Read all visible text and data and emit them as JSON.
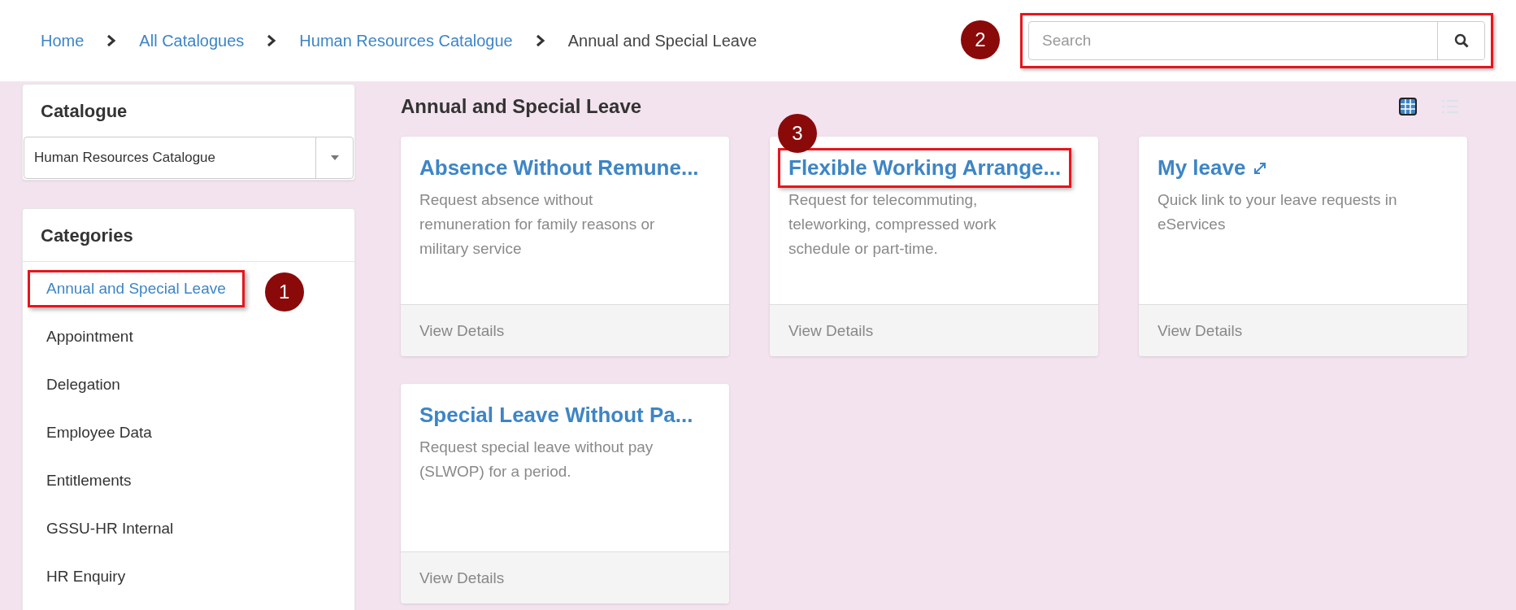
{
  "breadcrumb": [
    {
      "label": "Home",
      "link": true
    },
    {
      "label": "All Catalogues",
      "link": true
    },
    {
      "label": "Human Resources Catalogue",
      "link": true
    },
    {
      "label": "Annual and Special Leave",
      "link": false
    }
  ],
  "search": {
    "placeholder": "Search",
    "highlighted": true,
    "callout": "2"
  },
  "sidebar": {
    "catalogue": {
      "title": "Catalogue",
      "value": "Human Resources Catalogue"
    },
    "categories": {
      "title": "Categories",
      "items": [
        {
          "label": "Annual and Special Leave",
          "selected": true,
          "highlighted": true,
          "callout": "1"
        },
        {
          "label": "Appointment",
          "selected": false,
          "highlighted": false
        },
        {
          "label": "Delegation",
          "selected": false,
          "highlighted": false
        },
        {
          "label": "Employee Data",
          "selected": false,
          "highlighted": false
        },
        {
          "label": "Entitlements",
          "selected": false,
          "highlighted": false
        },
        {
          "label": "GSSU-HR Internal",
          "selected": false,
          "highlighted": false
        },
        {
          "label": "HR Enquiry",
          "selected": false,
          "highlighted": false
        }
      ]
    }
  },
  "main": {
    "title": "Annual and Special Leave",
    "view_toggle": [
      {
        "kind": "grid",
        "selected": true
      },
      {
        "kind": "list",
        "selected": false
      }
    ],
    "cards": [
      {
        "title": "Absence Without Remune...",
        "external": false,
        "highlighted": false,
        "description": "Request absence without remuneration for family reasons or military service",
        "action": "View Details"
      },
      {
        "title": "Flexible Working Arrange...",
        "external": false,
        "highlighted": true,
        "callout": "3",
        "description": "Request for telecommuting, teleworking, compressed work schedule or part-time.",
        "action": "View Details"
      },
      {
        "title": "My leave",
        "external": true,
        "highlighted": false,
        "description": "Quick link to your leave requests in eServices",
        "action": "View Details"
      },
      {
        "title": "Special Leave Without Pa...",
        "external": false,
        "highlighted": false,
        "description": "Request special leave without pay (SLWOP) for a period.",
        "action": "View Details"
      }
    ]
  }
}
